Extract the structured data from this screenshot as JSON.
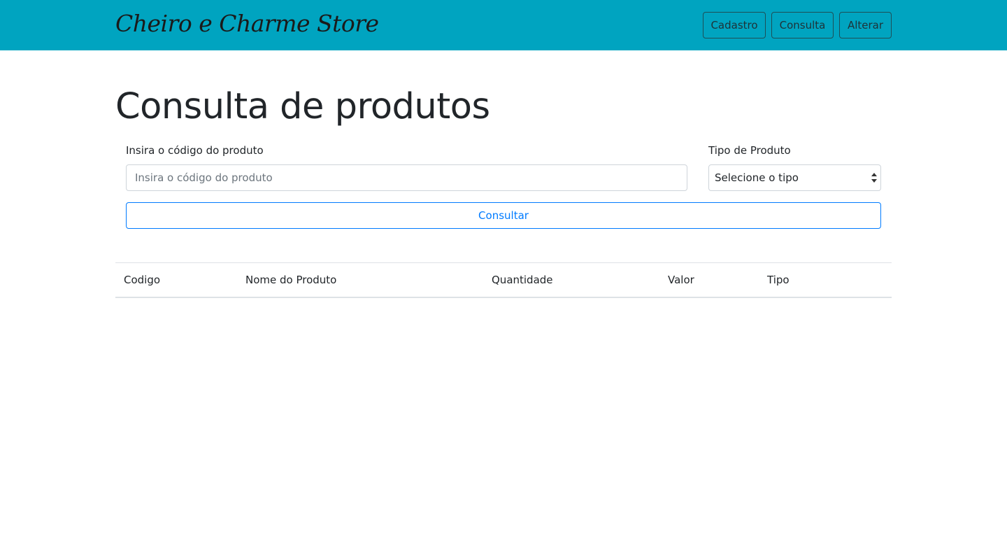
{
  "navbar": {
    "brand": "Cheiro e Charme Store",
    "links": [
      "Cadastro",
      "Consulta",
      "Alterar"
    ]
  },
  "main": {
    "title": "Consulta de produtos",
    "codigo_label": "Insira o código do produto",
    "codigo_placeholder": "Insira o código do produto",
    "codigo_value": "",
    "tipo_label": "Tipo de Produto",
    "tipo_selected": "Selecione o tipo",
    "consultar_label": "Consultar"
  },
  "table": {
    "headers": [
      "Codigo",
      "Nome do Produto",
      "Quantidade",
      "Valor",
      "Tipo"
    ],
    "rows": []
  },
  "colors": {
    "navbar_bg": "#00a4c0",
    "primary": "#007bff"
  }
}
